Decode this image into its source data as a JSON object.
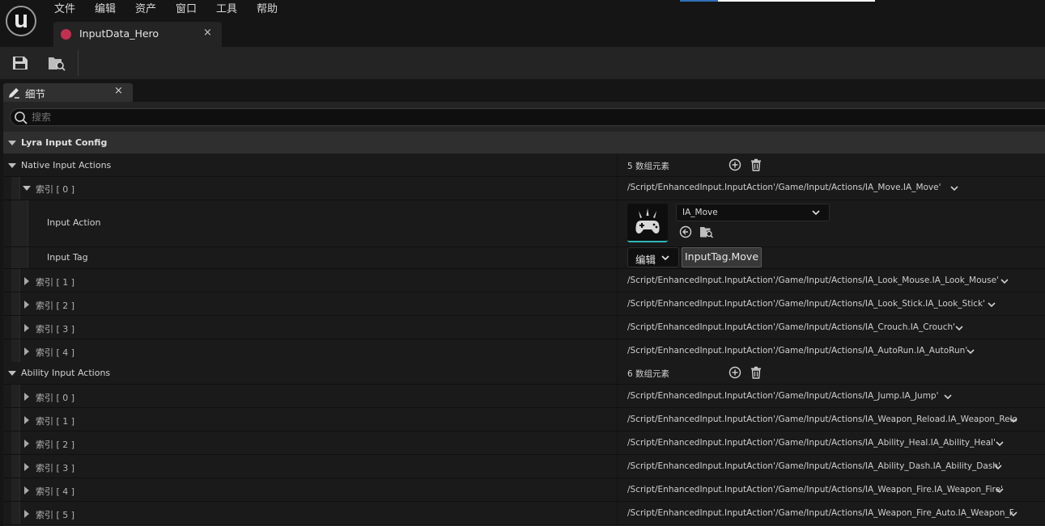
{
  "menu": [
    "文件",
    "编辑",
    "资产",
    "窗口",
    "工具",
    "帮助"
  ],
  "document_tab": {
    "label": "InputData_Hero",
    "close": "×"
  },
  "details_tab": {
    "label": "细节",
    "close": "×"
  },
  "search": {
    "placeholder": "搜索",
    "value": ""
  },
  "category": {
    "label": "Lyra Input Config"
  },
  "native": {
    "label": "Native Input Actions",
    "count": "5 数组元素",
    "expanded_index": {
      "label": "索引 [ 0 ]",
      "value": "/Script/EnhancedInput.InputAction'/Game/Input/Actions/IA_Move.IA_Move'",
      "input_action_label": "Input Action",
      "input_action_value": "IA_Move",
      "input_tag_label": "Input Tag",
      "edit_label": "编辑",
      "tag_value": "InputTag.Move"
    },
    "items": [
      {
        "label": "索引 [ 1 ]",
        "value": "/Script/EnhancedInput.InputAction'/Game/Input/Actions/IA_Look_Mouse.IA_Look_Mouse'"
      },
      {
        "label": "索引 [ 2 ]",
        "value": "/Script/EnhancedInput.InputAction'/Game/Input/Actions/IA_Look_Stick.IA_Look_Stick'"
      },
      {
        "label": "索引 [ 3 ]",
        "value": "/Script/EnhancedInput.InputAction'/Game/Input/Actions/IA_Crouch.IA_Crouch'"
      },
      {
        "label": "索引 [ 4 ]",
        "value": "/Script/EnhancedInput.InputAction'/Game/Input/Actions/IA_AutoRun.IA_AutoRun'"
      }
    ]
  },
  "ability": {
    "label": "Ability Input Actions",
    "count": "6 数组元素",
    "items": [
      {
        "label": "索引 [ 0 ]",
        "value": "/Script/EnhancedInput.InputAction'/Game/Input/Actions/IA_Jump.IA_Jump'"
      },
      {
        "label": "索引 [ 1 ]",
        "value": "/Script/EnhancedInput.InputAction'/Game/Input/Actions/IA_Weapon_Reload.IA_Weapon_Relo"
      },
      {
        "label": "索引 [ 2 ]",
        "value": "/Script/EnhancedInput.InputAction'/Game/Input/Actions/IA_Ability_Heal.IA_Ability_Heal'"
      },
      {
        "label": "索引 [ 3 ]",
        "value": "/Script/EnhancedInput.InputAction'/Game/Input/Actions/IA_Ability_Dash.IA_Ability_Dash'"
      },
      {
        "label": "索引 [ 4 ]",
        "value": "/Script/EnhancedInput.InputAction'/Game/Input/Actions/IA_Weapon_Fire.IA_Weapon_Fire'"
      },
      {
        "label": "索引 [ 5 ]",
        "value": "/Script/EnhancedInput.InputAction'/Game/Input/Actions/IA_Weapon_Fire_Auto.IA_Weapon_F"
      }
    ]
  },
  "colors": {
    "accent_teal": "#2fb8b8",
    "asset_pink": "#c2304f",
    "panel": "#242424"
  },
  "icons": [
    "unreal-logo-icon",
    "save-icon",
    "browse-icon",
    "pencil-icon",
    "search-icon",
    "add-icon",
    "trash-icon",
    "chevron-down-icon",
    "back-arrow-icon",
    "gamepad-icon"
  ]
}
